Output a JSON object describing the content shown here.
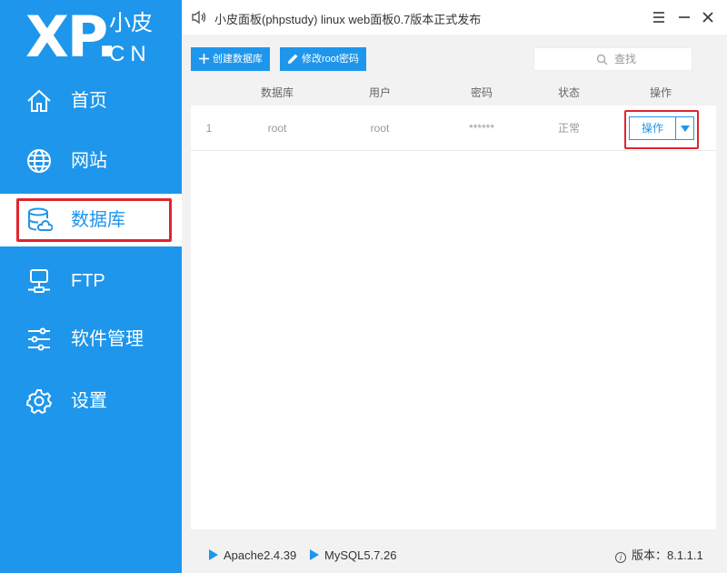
{
  "logo": {
    "main": "XP.",
    "cn_top": "小皮",
    "cn_bottom": "CN"
  },
  "sidebar": {
    "items": [
      {
        "label": "首页",
        "icon": "home-icon"
      },
      {
        "label": "网站",
        "icon": "globe-icon"
      },
      {
        "label": "数据库",
        "icon": "database-icon",
        "active": true
      },
      {
        "label": "FTP",
        "icon": "server-icon"
      },
      {
        "label": "软件管理",
        "icon": "sliders-icon"
      },
      {
        "label": "设置",
        "icon": "gear-icon"
      }
    ]
  },
  "window": {
    "title": "小皮面板(phpstudy) linux web面板0.7版本正式发布",
    "controls": [
      "menu-icon",
      "minimize-icon",
      "close-icon"
    ]
  },
  "toolbar": {
    "create_label": "创建数据库",
    "modify_label": "修改root密码",
    "search_placeholder": "查找"
  },
  "table": {
    "headers": [
      "数据库",
      "用户",
      "密码",
      "状态",
      "操作"
    ],
    "rows": [
      {
        "index": "1",
        "database": "root",
        "user": "root",
        "password": "******",
        "status": "正常",
        "action": "操作"
      }
    ]
  },
  "footer": {
    "apache": "Apache2.4.39",
    "mysql": "MySQL5.7.26",
    "version": "版本：8.1.1.1"
  },
  "colors": {
    "accent": "#1e96eb",
    "highlight": "#e0252d",
    "background": "#f2f2f2"
  }
}
